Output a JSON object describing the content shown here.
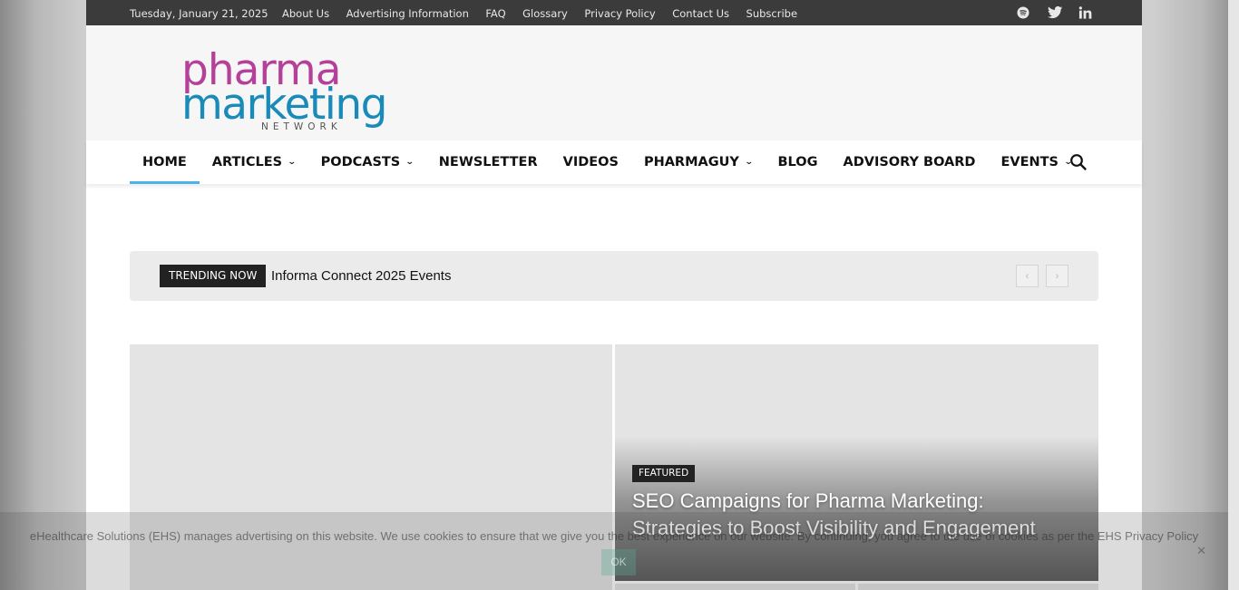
{
  "topbar": {
    "date": "Tuesday, January 21, 2025",
    "links": [
      "About Us",
      "Advertising Information",
      "FAQ",
      "Glossary",
      "Privacy Policy",
      "Contact Us",
      "Subscribe"
    ],
    "social_icons": [
      "spotify-icon",
      "twitter-icon",
      "linkedin-icon"
    ]
  },
  "logo": {
    "line1": "pharma",
    "line2": "marketing",
    "line3": "NETWORK",
    "color_pink": "#b5409a",
    "color_blue": "#1a8ab8"
  },
  "nav": {
    "items": [
      {
        "label": "HOME",
        "has_dropdown": false,
        "active": true
      },
      {
        "label": "ARTICLES",
        "has_dropdown": true
      },
      {
        "label": "PODCASTS",
        "has_dropdown": true
      },
      {
        "label": "NEWSLETTER",
        "has_dropdown": false
      },
      {
        "label": "VIDEOS",
        "has_dropdown": false
      },
      {
        "label": "PHARMAGUY",
        "has_dropdown": true
      },
      {
        "label": "BLOG",
        "has_dropdown": false
      },
      {
        "label": "ADVISORY BOARD",
        "has_dropdown": false
      },
      {
        "label": "EVENTS",
        "has_dropdown": true
      }
    ],
    "accent": "#4db2ec"
  },
  "trending": {
    "tag": "TRENDING NOW",
    "headline": "Informa Connect 2025 Events"
  },
  "featured": {
    "badge": "FEATURED",
    "title": "SEO Campaigns for Pharma Marketing: Strategies to Boost Visibility and Engagement"
  },
  "cookie": {
    "message": "eHealthcare Solutions (EHS) manages advertising on this website. We use cookies to ensure that we give you the best experience on our website. By continuing, you agree to the use of cookies as per the ",
    "link": "EHS Privacy Policy",
    "ok": "OK",
    "close": "✕"
  }
}
